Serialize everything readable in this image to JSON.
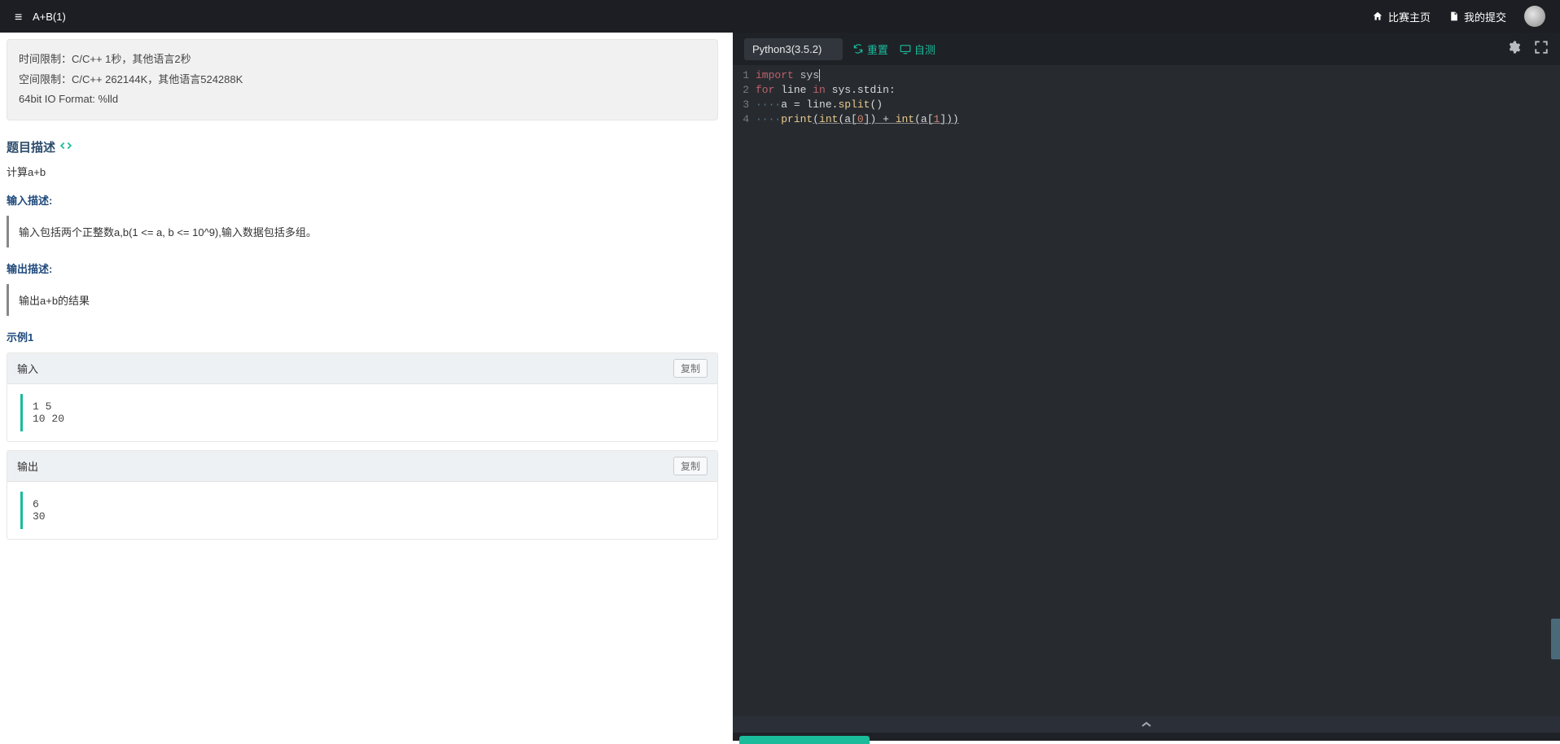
{
  "header": {
    "title": "A+B(1)",
    "nav_home": "比赛主页",
    "nav_submit": "我的提交"
  },
  "limits": {
    "time": "时间限制：C/C++ 1秒，其他语言2秒",
    "space": "空间限制：C/C++ 262144K，其他语言524288K",
    "io": "64bit IO Format: %lld"
  },
  "sections": {
    "desc_title": "题目描述",
    "desc_body": "计算a+b",
    "input_title": "输入描述:",
    "input_body": "输入包括两个正整数a,b(1 <= a, b <= 10^9),输入数据包括多组。",
    "output_title": "输出描述:",
    "output_body": "输出a+b的结果",
    "example_label": "示例1",
    "input_box_label": "输入",
    "output_box_label": "输出",
    "copy_label": "复制",
    "sample_in": "1 5\n10 20",
    "sample_out": "6\n30"
  },
  "editor": {
    "language": "Python3(3.5.2)",
    "reset": "重置",
    "selftest": "自测",
    "line1": "1",
    "line2": "2",
    "line3": "3",
    "line4": "4"
  },
  "code_tokens": {
    "import": "import",
    "sys": "sys",
    "for": "for",
    "line": "line",
    "in": "in",
    "sys_stdin": "sys.stdin",
    "colon": ":",
    "dotsp": "····",
    "a_eq": "a = line.",
    "split": "split",
    "paren": "()",
    "print": "print",
    "lp": "(",
    "int": "int",
    "a0": "(a[",
    "zero": "0",
    "close_a0": "]) + ",
    "a1": "(a[",
    "one": "1",
    "close_a1": "]))"
  },
  "icons": {
    "home": "home-icon",
    "doc": "doc-icon",
    "list": "list-icon",
    "code": "code-icon",
    "refresh": "refresh-icon",
    "screen": "screen-icon",
    "gear": "gear-icon",
    "fullscreen": "fullscreen-icon",
    "chevron_up": "chevron-up-icon"
  }
}
